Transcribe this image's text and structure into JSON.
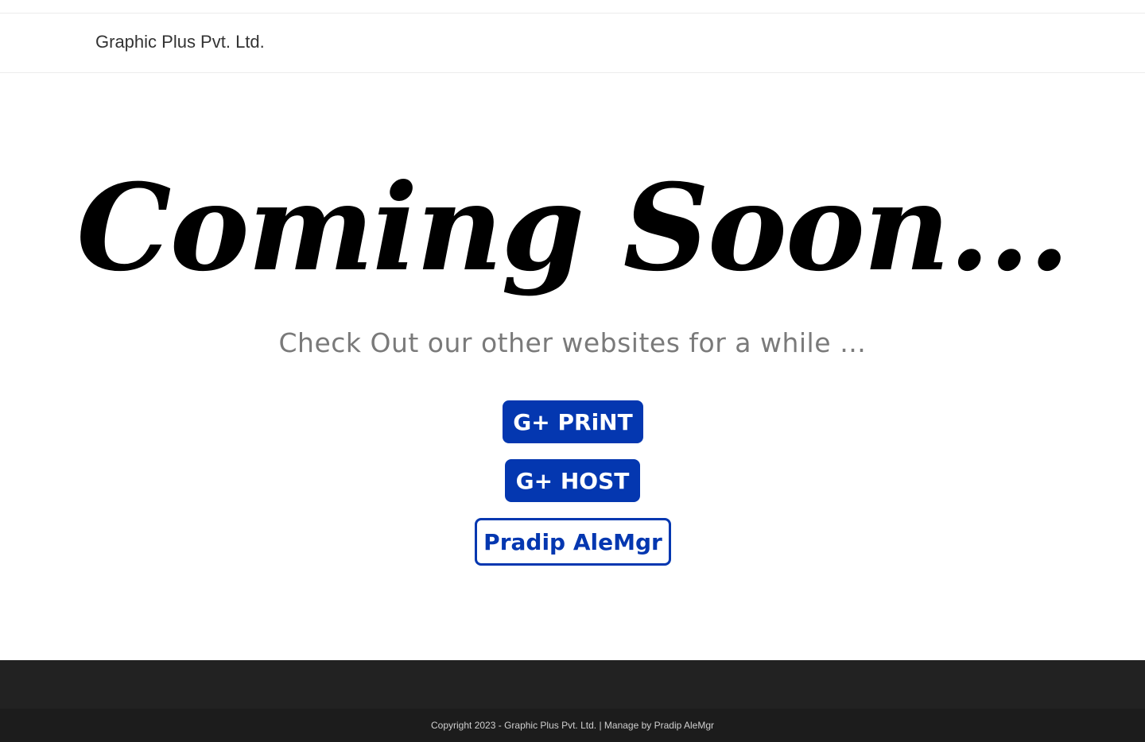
{
  "header": {
    "site_title": "Graphic Plus Pvt. Ltd."
  },
  "hero": {
    "title": "Coming Soon...",
    "subtitle": "Check Out our other websites for a while …"
  },
  "buttons": {
    "print_label": "G+ PRiNT",
    "host_label": "G+ HOST",
    "pradip_label": "Pradip AleMgr"
  },
  "footer": {
    "copyright_prefix": "Copyright 2023 - ",
    "company_link": "Graphic Plus Pvt. Ltd.",
    "separator": " | Manage by ",
    "manager_link": "Pradip AleMgr"
  },
  "colors": {
    "accent": "#0437b0",
    "footer_top": "#222222",
    "footer_bottom": "#1c1c1c",
    "subtitle": "#7a7a7a"
  }
}
